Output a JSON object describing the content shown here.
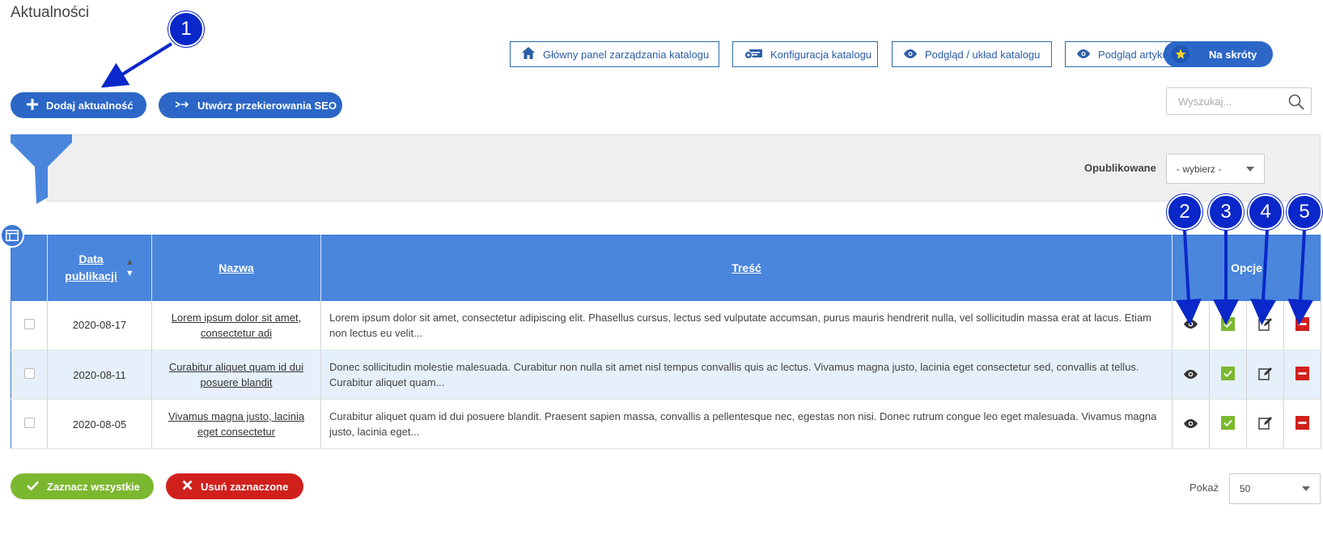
{
  "page": {
    "title": "Aktualności"
  },
  "toolbar": {
    "main_panel": "Główny panel zarządzania katalogu",
    "catalog_config": "Konfiguracja katalogu",
    "catalog_preview": "Podgląd / układ katalogu",
    "article_preview": "Podgląd artykułu",
    "shortcuts": "Na skróty"
  },
  "actions": {
    "add_news": "Dodaj aktualność",
    "seo_redirects": "Utwórz przekierowania SEO"
  },
  "search": {
    "placeholder": "Wyszukaj..."
  },
  "filter": {
    "published_label": "Opublikowane",
    "published_value": "- wybierz -"
  },
  "table": {
    "headers": {
      "date_line1": "Data",
      "date_line2": "publikacji",
      "name": "Nazwa",
      "content": "Treść",
      "options": "Opcje"
    },
    "sort_asc": "▲",
    "sort_desc": "▼",
    "rows": [
      {
        "date": "2020-08-17",
        "name": "Lorem ipsum dolor sit amet, consectetur adi",
        "content": "Lorem ipsum dolor sit amet, consectetur adipiscing elit. Phasellus cursus, lectus sed vulputate accumsan, purus mauris hendrerit nulla, vel sollicitudin massa erat at lacus. Etiam non lectus eu velit..."
      },
      {
        "date": "2020-08-11",
        "name": "Curabitur aliquet quam id dui posuere blandit",
        "content": "Donec sollicitudin molestie malesuada. Curabitur non nulla sit amet nisl tempus convallis quis ac lectus. Vivamus magna justo, lacinia eget consectetur sed, convallis at tellus. Curabitur aliquet quam..."
      },
      {
        "date": "2020-08-05",
        "name": "Vivamus magna justo, lacinia eget consectetur",
        "content": "Curabitur aliquet quam id dui posuere blandit. Praesent sapien massa, convallis a pellentesque nec, egestas non nisi. Donec rutrum congue leo eget malesuada. Vivamus magna justo, lacinia eget..."
      }
    ]
  },
  "bottom": {
    "select_all": "Zaznacz wszystkie",
    "delete_selected": "Usuń zaznaczone",
    "show_label": "Pokaż",
    "show_value": "50"
  },
  "annotations": [
    "1",
    "2",
    "3",
    "4",
    "5"
  ],
  "colors": {
    "primary": "#2c67c7",
    "header_bg": "#4a86dc",
    "green": "#7cb82f",
    "red": "#d0201c",
    "callout": "#0a27c9"
  }
}
